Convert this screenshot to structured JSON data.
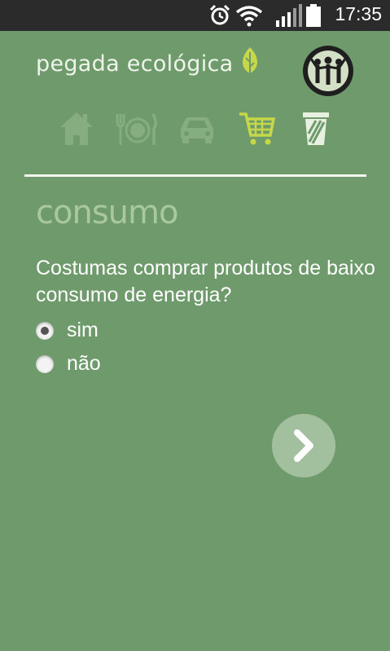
{
  "status_bar": {
    "time": "17:35",
    "icons": [
      "alarm-icon",
      "wifi-icon",
      "signal-icon",
      "battery-icon"
    ]
  },
  "header": {
    "brand": "pegada ecológica",
    "people_button_icon": "people-icon"
  },
  "nav": {
    "tabs": [
      {
        "name": "home",
        "icon": "house-icon",
        "active": false
      },
      {
        "name": "food",
        "icon": "cutlery-plate-icon",
        "active": false
      },
      {
        "name": "transport",
        "icon": "car-icon",
        "active": false
      },
      {
        "name": "shopping",
        "icon": "shopping-cart-icon",
        "active": true
      },
      {
        "name": "waste",
        "icon": "trash-icon",
        "active": false
      }
    ]
  },
  "section": {
    "title": "consumo"
  },
  "question": {
    "text": "Costumas comprar produtos de baixo consumo de energia?",
    "options": [
      {
        "label": "sim",
        "selected": true
      },
      {
        "label": "não",
        "selected": false
      }
    ]
  },
  "next_button": {
    "icon": "chevron-right-icon"
  },
  "colors": {
    "background": "#6f9b6c",
    "accent": "#c6d84a",
    "inactive_icon": "#a3c09e",
    "text": "#ffffff"
  }
}
